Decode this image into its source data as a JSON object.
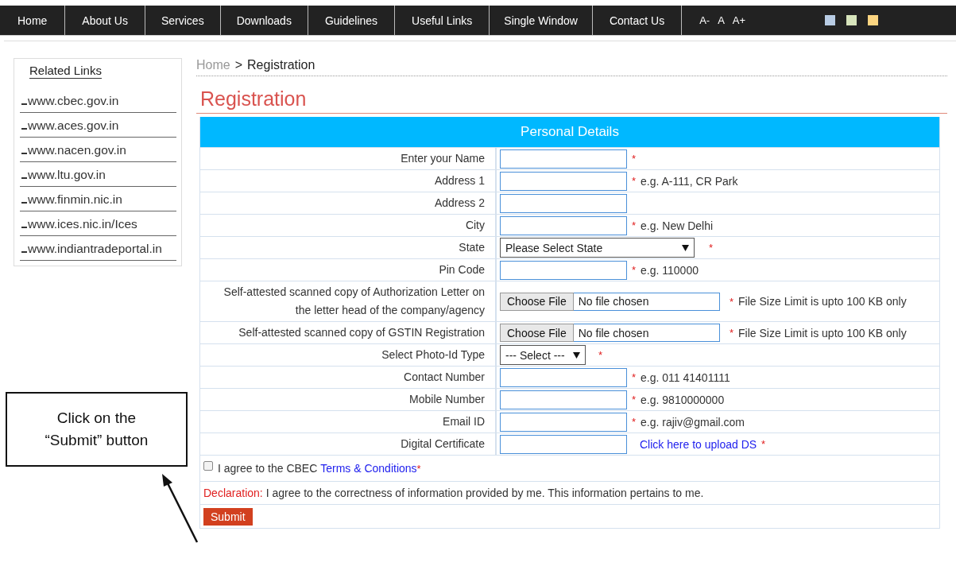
{
  "nav": {
    "items": [
      {
        "label": "Home"
      },
      {
        "label": "About Us"
      },
      {
        "label": "Services"
      },
      {
        "label": "Downloads"
      },
      {
        "label": "Guidelines"
      },
      {
        "label": "Useful Links"
      },
      {
        "label": "Single Window"
      },
      {
        "label": "Contact Us"
      }
    ],
    "font_sizes": [
      "A-",
      "A",
      "A+"
    ],
    "themes": [
      {
        "color": "#b8cce4"
      },
      {
        "color": "#d7e4bc"
      },
      {
        "color": "#fcd581"
      }
    ]
  },
  "sidebar": {
    "title": "Related Links",
    "links": [
      "www.cbec.gov.in",
      "www.aces.gov.in",
      "www.nacen.gov.in",
      "www.ltu.gov.in",
      "www.finmin.nic.in",
      "www.ices.nic.in/Ices",
      "www.indiantradeportal.in"
    ]
  },
  "breadcrumb": {
    "home": "Home",
    "separator": ">",
    "current": "Registration"
  },
  "page_title": "Registration",
  "form": {
    "section_title": "Personal Details",
    "rows": [
      {
        "kind": "text",
        "label": "Enter your Name",
        "mark": "*"
      },
      {
        "kind": "text",
        "label": "Address 1",
        "mark": "*",
        "hint": "e.g. A-111, CR Park"
      },
      {
        "kind": "text",
        "label": "Address 2"
      },
      {
        "kind": "text",
        "label": "City",
        "mark": "*",
        "hint": "e.g. New Delhi"
      },
      {
        "kind": "wideselect",
        "label": "State",
        "value": "Please Select State",
        "mark": "*"
      },
      {
        "kind": "text",
        "label": "Pin Code",
        "mark": "*",
        "hint": "e.g. 110000"
      },
      {
        "kind": "file",
        "label": "Self-attested scanned copy of Authorization Letter on the letter head of the company/agency",
        "button": "Choose File",
        "status": "No file chosen",
        "mark": "*",
        "hint": "File Size Limit is upto 100 KB only"
      },
      {
        "kind": "file",
        "label": "Self-attested scanned copy of GSTIN Registration",
        "button": "Choose File",
        "status": "No file chosen",
        "mark": "*",
        "hint": "File Size Limit is upto 100 KB only"
      },
      {
        "kind": "select",
        "label": "Select Photo-Id Type",
        "value": "--- Select ---",
        "mark": "*"
      },
      {
        "kind": "text",
        "label": "Contact Number",
        "mark": "*",
        "hint": "e.g. 011 41401111"
      },
      {
        "kind": "text",
        "label": "Mobile Number",
        "mark": "*",
        "hint": "e.g. 9810000000"
      },
      {
        "kind": "text",
        "label": "Email ID",
        "mark": "*",
        "hint": "e.g. rajiv@gmail.com"
      },
      {
        "kind": "upload",
        "label": "Digital Certificate",
        "link": "Click here to upload DS",
        "mark": "*"
      }
    ],
    "agreement": {
      "checked": false,
      "text": "I agree to the CBEC",
      "link": "Terms & Conditions",
      "mark": "*"
    },
    "declaration": {
      "label": "Declaration:",
      "text": "I agree to the correctness of information provided by me. This information pertains to me."
    },
    "submit": "Submit"
  },
  "callout": {
    "lines": [
      "Click on the",
      "“Submit” button"
    ]
  }
}
